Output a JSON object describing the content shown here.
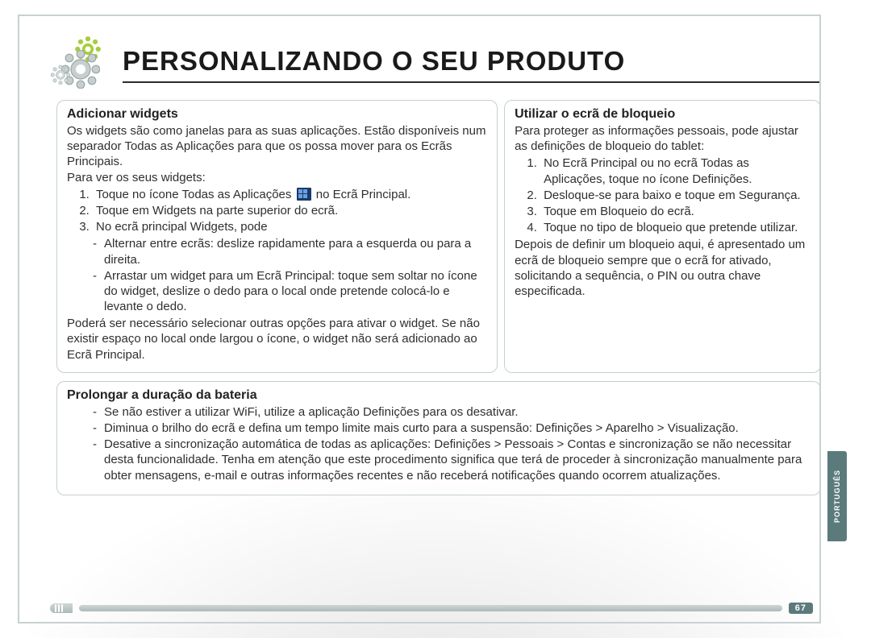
{
  "title": "PERSONALIZANDO O SEU PRODUTO",
  "page_number": "67",
  "language_tab": "PORTUGUÊS",
  "box_widgets": {
    "heading": "Adicionar widgets",
    "intro": "Os widgets são como janelas para as suas aplicações. Estão disponíveis num separador Todas as Aplicações para que os possa mover para os Ecrãs Principais.",
    "lead": "Para ver os seus widgets:",
    "step1_a": "Toque no ícone Todas as Aplicações ",
    "step1_b": " no Ecrã Principal.",
    "step2": "Toque em Widgets na parte superior do ecrã.",
    "step3": "No ecrã principal Widgets, pode",
    "bullet1": "Alternar entre ecrãs: deslize rapidamente para a esquerda ou para a direita.",
    "bullet2": "Arrastar um widget para um Ecrã Principal: toque sem soltar no ícone do widget, deslize o dedo para o local onde pretende colocá-lo e levante o dedo.",
    "after": "Poderá ser necessário selecionar outras opções para ativar o widget. Se não existir espaço no local onde largou o ícone, o widget não será adicionado ao Ecrã Principal."
  },
  "box_lock": {
    "heading": "Utilizar o ecrã de bloqueio",
    "intro": "Para proteger as informações pessoais, pode ajustar as definições de bloqueio do tablet:",
    "step1": "No Ecrã Principal ou no ecrã Todas as Aplicações, toque no ícone Definições.",
    "step2": "Desloque-se para baixo e toque em Segurança.",
    "step3": "Toque em Bloqueio do ecrã.",
    "step4": "Toque no tipo de bloqueio que pretende utilizar.",
    "after": "Depois de definir um bloqueio aqui, é apresentado um ecrã de bloqueio sempre que o ecrã for ativado, solicitando a sequência, o PIN ou outra chave especificada."
  },
  "box_battery": {
    "heading": "Prolongar a duração da bateria",
    "b1": "Se não estiver a utilizar WiFi, utilize a aplicação Definições para os desativar.",
    "b2": "Diminua o brilho do ecrã e defina um tempo limite mais curto para a suspensão: Definições > Aparelho > Visualização.",
    "b3": "Desative a sincronização automática de todas as aplicações: Definições > Pessoais > Contas e sincronização se não necessitar desta funcionalidade. Tenha em atenção que este procedimento significa que terá de proceder à sincronização manualmente para obter mensagens, e-mail e outras informações recentes e não receberá notificações quando ocorrem atualizações."
  }
}
